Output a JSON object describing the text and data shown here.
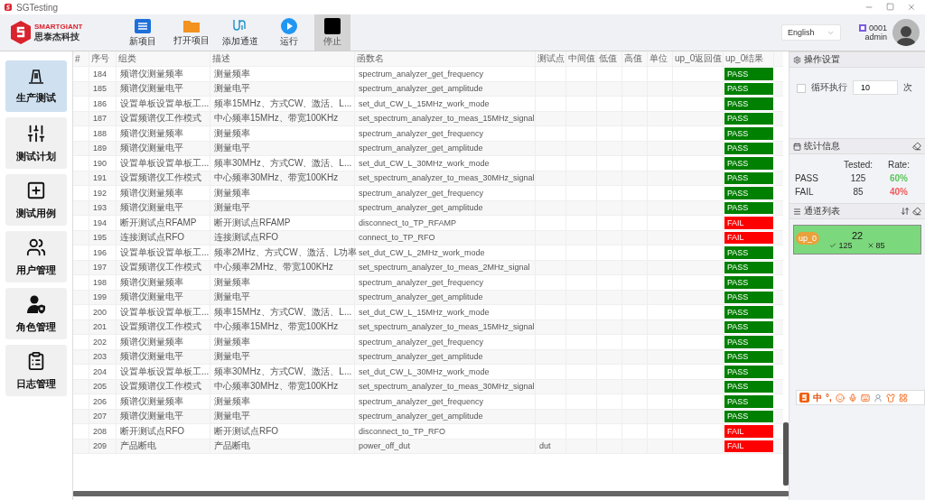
{
  "window": {
    "title": "SGTesting"
  },
  "logo": {
    "name": "SMARTGIANT",
    "subtitle": "思泰杰科技"
  },
  "toolbar": [
    {
      "label": "新项目",
      "kind": "new",
      "selected": false
    },
    {
      "label": "打开项目",
      "kind": "open",
      "selected": false
    },
    {
      "label": "添加通道",
      "kind": "channel",
      "selected": false
    },
    {
      "label": "运行",
      "kind": "run",
      "selected": false
    },
    {
      "label": "停止",
      "kind": "stop",
      "selected": true
    }
  ],
  "language": "English",
  "user": {
    "id": "0001",
    "name": "admin"
  },
  "sidebar": {
    "items": [
      {
        "label": "生产测试",
        "kind": "production",
        "selected": true
      },
      {
        "label": "测试计划",
        "kind": "plan",
        "selected": false
      },
      {
        "label": "测试用例",
        "kind": "case",
        "selected": false
      },
      {
        "label": "用户管理",
        "kind": "users",
        "selected": false
      },
      {
        "label": "角色管理",
        "kind": "roles",
        "selected": false
      },
      {
        "label": "日志管理",
        "kind": "log",
        "selected": false
      }
    ]
  },
  "table": {
    "columns": [
      "#",
      "序号",
      "组类",
      "描述",
      "函数名",
      "测试点",
      "中间值",
      "低值",
      "高值",
      "单位",
      "up_0返回值",
      "up_0结果"
    ],
    "rows": [
      {
        "no": "184",
        "group": "频谱仪测量频率",
        "desc": "测量频率",
        "func": "spectrum_analyzer_get_frequency",
        "result": "PASS",
        "passed": true
      },
      {
        "no": "185",
        "group": "频谱仪测量电平",
        "desc": "测量电平",
        "func": "spectrum_analyzer_get_amplitude",
        "result": "PASS",
        "passed": true
      },
      {
        "no": "186",
        "group": "设置单板设置单板工...",
        "desc": "频率15MHz、方式CW、激活、L...",
        "func": "set_dut_CW_L_15MHz_work_mode",
        "result": "PASS",
        "passed": true
      },
      {
        "no": "187",
        "group": "设置频谱仪工作模式",
        "desc": "中心频率15MHz、带宽100KHz",
        "func": "set_spectrum_analyzer_to_meas_15MHz_signal",
        "result": "PASS",
        "passed": true
      },
      {
        "no": "188",
        "group": "频谱仪测量频率",
        "desc": "测量频率",
        "func": "spectrum_analyzer_get_frequency",
        "result": "PASS",
        "passed": true
      },
      {
        "no": "189",
        "group": "频谱仪测量电平",
        "desc": "测量电平",
        "func": "spectrum_analyzer_get_amplitude",
        "result": "PASS",
        "passed": true
      },
      {
        "no": "190",
        "group": "设置单板设置单板工...",
        "desc": "频率30MHz、方式CW、激活、L...",
        "func": "set_dut_CW_L_30MHz_work_mode",
        "result": "PASS",
        "passed": true
      },
      {
        "no": "191",
        "group": "设置频谱仪工作模式",
        "desc": "中心频率30MHz、带宽100KHz",
        "func": "set_spectrum_analyzer_to_meas_30MHz_signal",
        "result": "PASS",
        "passed": true
      },
      {
        "no": "192",
        "group": "频谱仪测量频率",
        "desc": "测量频率",
        "func": "spectrum_analyzer_get_frequency",
        "result": "PASS",
        "passed": true
      },
      {
        "no": "193",
        "group": "频谱仪测量电平",
        "desc": "测量电平",
        "func": "spectrum_analyzer_get_amplitude",
        "result": "PASS",
        "passed": true
      },
      {
        "no": "194",
        "group": "断开测试点RFAMP",
        "desc": "断开测试点RFAMP",
        "func": "disconnect_to_TP_RFAMP",
        "result": "FAIL",
        "passed": false
      },
      {
        "no": "195",
        "group": "连接测试点RFO",
        "desc": "连接测试点RFO",
        "func": "connect_to_TP_RFO",
        "result": "FAIL",
        "passed": false
      },
      {
        "no": "196",
        "group": "设置单板设置单板工...",
        "desc": "频率2MHz、方式CW、激活、L功率",
        "func": "set_dut_CW_L_2MHz_work_mode",
        "result": "PASS",
        "passed": true
      },
      {
        "no": "197",
        "group": "设置频谱仪工作模式",
        "desc": "中心频率2MHz、带宽100KHz",
        "func": "set_spectrum_analyzer_to_meas_2MHz_signal",
        "result": "PASS",
        "passed": true
      },
      {
        "no": "198",
        "group": "频谱仪测量频率",
        "desc": "测量频率",
        "func": "spectrum_analyzer_get_frequency",
        "result": "PASS",
        "passed": true
      },
      {
        "no": "199",
        "group": "频谱仪测量电平",
        "desc": "测量电平",
        "func": "spectrum_analyzer_get_amplitude",
        "result": "PASS",
        "passed": true
      },
      {
        "no": "200",
        "group": "设置单板设置单板工...",
        "desc": "频率15MHz、方式CW、激活、L...",
        "func": "set_dut_CW_L_15MHz_work_mode",
        "result": "PASS",
        "passed": true
      },
      {
        "no": "201",
        "group": "设置频谱仪工作模式",
        "desc": "中心频率15MHz、带宽100KHz",
        "func": "set_spectrum_analyzer_to_meas_15MHz_signal",
        "result": "PASS",
        "passed": true
      },
      {
        "no": "202",
        "group": "频谱仪测量频率",
        "desc": "测量频率",
        "func": "spectrum_analyzer_get_frequency",
        "result": "PASS",
        "passed": true
      },
      {
        "no": "203",
        "group": "频谱仪测量电平",
        "desc": "测量电平",
        "func": "spectrum_analyzer_get_amplitude",
        "result": "PASS",
        "passed": true
      },
      {
        "no": "204",
        "group": "设置单板设置单板工...",
        "desc": "频率30MHz、方式CW、激活、L...",
        "func": "set_dut_CW_L_30MHz_work_mode",
        "result": "PASS",
        "passed": true
      },
      {
        "no": "205",
        "group": "设置频谱仪工作模式",
        "desc": "中心频率30MHz、带宽100KHz",
        "func": "set_spectrum_analyzer_to_meas_30MHz_signal",
        "result": "PASS",
        "passed": true
      },
      {
        "no": "206",
        "group": "频谱仪测量频率",
        "desc": "测量频率",
        "func": "spectrum_analyzer_get_frequency",
        "result": "PASS",
        "passed": true
      },
      {
        "no": "207",
        "group": "频谱仪测量电平",
        "desc": "测量电平",
        "func": "spectrum_analyzer_get_amplitude",
        "result": "PASS",
        "passed": true
      },
      {
        "no": "208",
        "group": "断开测试点RFO",
        "desc": "断开测试点RFO",
        "func": "disconnect_to_TP_RFO",
        "result": "FAIL",
        "passed": false
      },
      {
        "no": "209",
        "group": "产品断电",
        "desc": "产品断电",
        "func": "power_off_dut",
        "point": "dut",
        "result": "FAIL",
        "passed": false
      }
    ]
  },
  "settings": {
    "title": "操作设置",
    "loop_label": "循环执行",
    "loop_checked": false,
    "loop_count": "10",
    "unit": "次"
  },
  "stats": {
    "title": "统计信息",
    "headers": [
      "Tested:",
      "Rate:"
    ],
    "rows": [
      {
        "label": "PASS",
        "tested": "125",
        "rate": "60%",
        "color": "#5cc65c"
      },
      {
        "label": "FAIL",
        "tested": "85",
        "rate": "40%",
        "color": "#f05a5a"
      }
    ]
  },
  "channels": {
    "title": "通道列表",
    "items": [
      {
        "name": "up_0",
        "count": "22",
        "pass": "125",
        "fail": "85"
      }
    ]
  },
  "ime": {
    "mode": "中",
    "punct": "°,"
  }
}
